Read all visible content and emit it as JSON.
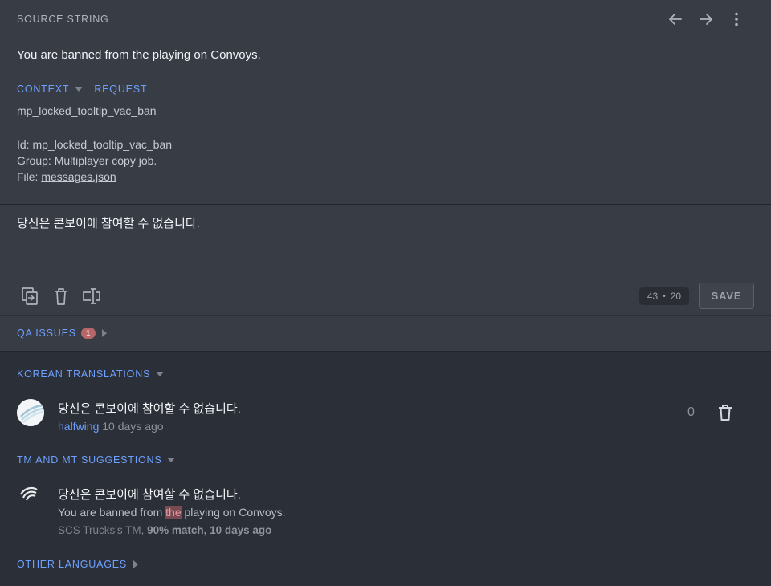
{
  "source": {
    "title": "SOURCE STRING",
    "text": "You are banned from the playing on Convoys.",
    "context_tab": "CONTEXT",
    "request_tab": "REQUEST",
    "context_key": "mp_locked_tooltip_vac_ban",
    "id_line": "Id: mp_locked_tooltip_vac_ban",
    "group_line": "Group: Multiplayer copy job.",
    "file_prefix": "File: ",
    "file_name": "messages.json",
    "icons": [
      "arrow-left-icon",
      "arrow-right-icon",
      "more-vertical-icon"
    ]
  },
  "editor": {
    "text": "당신은 콘보이에 참여할 수 없습니다.",
    "counter_source": "43",
    "counter_separator": "•",
    "counter_target": "20",
    "save_label": "SAVE",
    "tools": [
      "copy-source-icon",
      "clear-icon",
      "text-cursor-icon"
    ]
  },
  "qa": {
    "title": "QA ISSUES",
    "count": "1"
  },
  "translations": {
    "title": "KOREAN TRANSLATIONS",
    "items": [
      {
        "text": "당신은 콘보이에 참여할 수 없습니다.",
        "author": "halfwing",
        "time": "10 days ago",
        "votes": "0"
      }
    ]
  },
  "suggestions": {
    "title": "TM AND MT SUGGESTIONS",
    "items": [
      {
        "text": "당신은 콘보이에 참여할 수 없습니다.",
        "source_before": "You are banned from ",
        "source_highlight": "the",
        "source_after": " playing on Convoys.",
        "meta_prefix": "SCS Trucks's TM, ",
        "meta_match": "90% match, 10 days ago"
      }
    ]
  },
  "other_languages": {
    "title": "OTHER LANGUAGES"
  },
  "colors": {
    "accent": "#6ea0ff",
    "panel": "#383c45",
    "background": "#2b2f37",
    "badge": "#b7666a",
    "highlight": "#7a4a52"
  }
}
